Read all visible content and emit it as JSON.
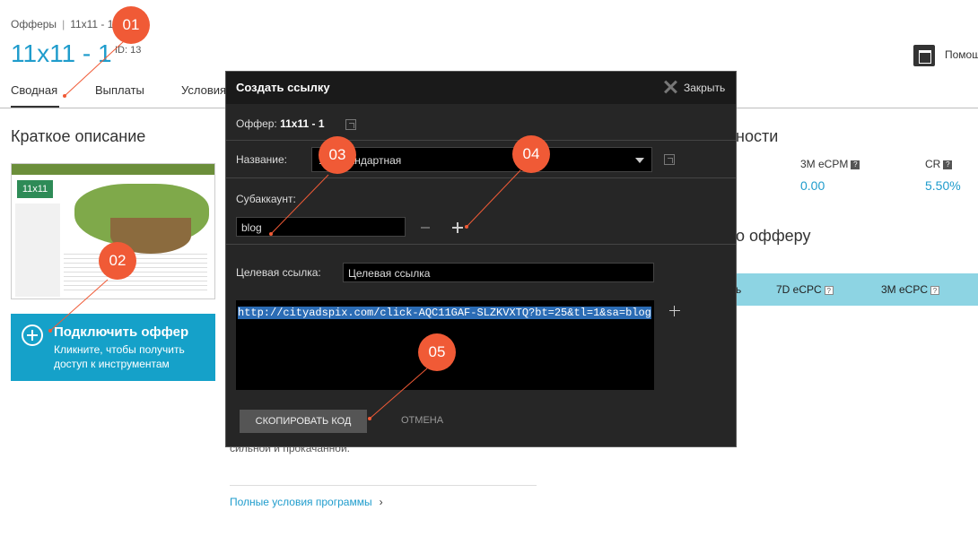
{
  "breadcrumb": {
    "offers": "Офферы",
    "separator": "|",
    "current": "11x11 - 1"
  },
  "header": {
    "title": "11x11 - 1",
    "id_label": "ID: 13",
    "help_label": "Помощ"
  },
  "tabs": [
    {
      "label": "Сводная"
    },
    {
      "label": "Выплаты"
    },
    {
      "label": "Условия"
    }
  ],
  "left": {
    "section_title": "Краткое описание",
    "thumbnail_logo": "11x11",
    "connect_title": "Подключить оффер",
    "connect_subtitle": "Кликните, чтобы получить доступ к инструментам"
  },
  "right": {
    "heading_partial": "ности",
    "stats": [
      {
        "label": "3M eCPM",
        "value": "0.00"
      },
      {
        "label": "CR",
        "value": "5.50%"
      }
    ],
    "heading2_partial": "о офферу",
    "bar_labels": [
      "ь",
      "7D eCPC",
      "3M eCPC"
    ],
    "help_glyph": "?"
  },
  "main": {
    "text_fragment": "сильной и прокачанной.",
    "full_terms_link": "Полные условия программы",
    "chevron": "›"
  },
  "modal": {
    "title": "Создать ссылку",
    "close_label": "Закрыть",
    "offer_label": "Оффер:",
    "offer_value": "11x11 - 1",
    "name_label": "Название:",
    "name_value": "Л                   - Стандартная",
    "subaccount_label": "Субаккаунт:",
    "subaccount_value": "blog",
    "target_label": "Целевая ссылка:",
    "target_placeholder": "Целевая ссылка",
    "generated_code": "http://cityadspix.com/click-AQC11GAF-SLZKVXTQ?bt=25&tl=1&sa=blog",
    "copy_button": "СКОПИРОВАТЬ КОД",
    "cancel_button": "ОТМЕНА"
  },
  "annotations": [
    "01",
    "02",
    "03",
    "04",
    "05"
  ],
  "colors": {
    "accent": "#1f9ccc",
    "connect_bg": "#15a1c9",
    "marker": "#f05a36",
    "modal_bg": "#262626"
  }
}
